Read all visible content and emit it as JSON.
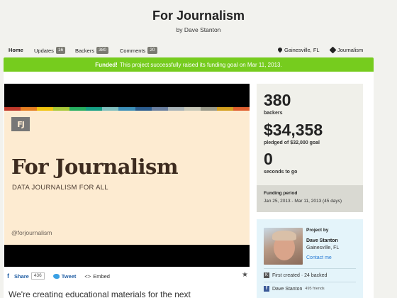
{
  "header": {
    "title": "For Journalism",
    "byline": "by Dave Stanton"
  },
  "nav": {
    "home": "Home",
    "updates": {
      "label": "Updates",
      "count": "16"
    },
    "backers": {
      "label": "Backers",
      "count": "380"
    },
    "comments": {
      "label": "Comments",
      "count": "20"
    },
    "location": "Gainesville, FL",
    "category": "Journalism"
  },
  "banner": {
    "strong": "Funded!",
    "text": "This project successfully raised its funding goal on Mar 11, 2013.",
    "color": "#76cc1e"
  },
  "video": {
    "logo": "FJ",
    "title": "For Journalism",
    "subtitle": "DATA JOURNALISM FOR ALL",
    "handle": "@forjournalism",
    "stripe_colors": [
      "#c0392b",
      "#e67e22",
      "#f1c40f",
      "#a8c93a",
      "#27ae60",
      "#16a085",
      "#7fbfbf",
      "#3d8fb8",
      "#2c5d8f",
      "#6a7fa0",
      "#a9b4b8",
      "#c8c8b8",
      "#9a9a8a",
      "#d4a020",
      "#e06030"
    ]
  },
  "share": {
    "facebook": "Share",
    "facebook_count": "436",
    "tweet": "Tweet",
    "embed": "Embed"
  },
  "teaser": "We're creating educational materials for the next",
  "stats": {
    "backers_num": "380",
    "backers_label": "backers",
    "pledged_num": "$34,358",
    "pledged_label": "pledged of $32,000 goal",
    "seconds_num": "0",
    "seconds_label": "seconds to go"
  },
  "period": {
    "title": "Funding period",
    "dates": "Jan 25, 2013 - Mar 11, 2013 (45 days)"
  },
  "creator": {
    "project_by": "Project by",
    "name": "Dave Stanton",
    "location": "Gainesville, FL",
    "contact": "Contact me",
    "created": "First created · 24 backed",
    "fb_name": "Dave Stanton",
    "fb_friends": "495 friends"
  }
}
